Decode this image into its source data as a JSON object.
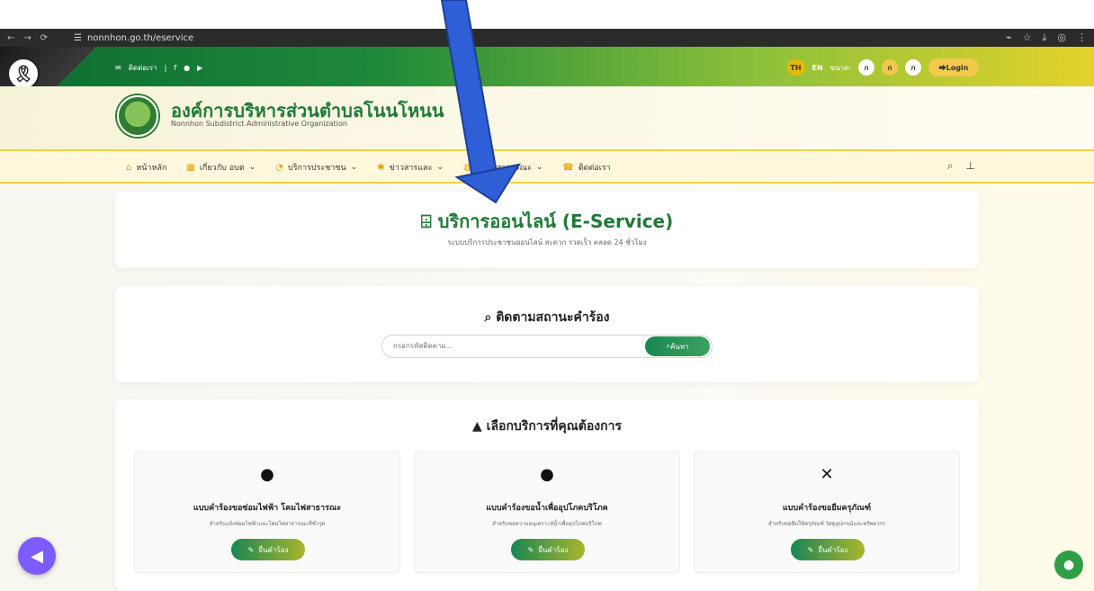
{
  "browser": {
    "url": "nonnhon.go.th/eservice"
  },
  "topbar": {
    "contact": "ติดต่อเรา",
    "lang_th": "TH",
    "lang_en": "EN",
    "size_label": "ขนาด:",
    "size_options": [
      "ก",
      "ก",
      "ก"
    ],
    "login": "Login"
  },
  "header": {
    "org_name": "องค์การบริหารส่วนตำบลโนนโหนน",
    "org_sub": "Nonnhon Subdistrict Administrative Organization"
  },
  "nav": {
    "items": [
      "หน้าหลัก",
      "เกี่ยวกับ อบต",
      "บริการประชาชน",
      "ข่าวสารและ",
      "ข้อมูลสาธารณะ",
      "ติดต่อเรา"
    ]
  },
  "hero": {
    "title": "บริการออนไลน์ (E-Service)",
    "subtitle": "ระบบบริการประชาชนออนไลน์ สะดวก รวดเร็ว ตลอด 24 ชั่วโมง"
  },
  "track": {
    "title": "ติดตามสถานะคำร้อง",
    "placeholder": "กรอกรหัสติดตาม...",
    "button": "ค้นหา"
  },
  "services": {
    "title": "เลือกบริการที่คุณต้องการ",
    "cards": [
      {
        "title": "แบบคำร้องขอซ่อมไฟฟ้า โคมไฟสาธารณะ",
        "desc": "สำหรับแจ้งซ่อมไฟฟ้าและโคมไฟสาธารณะที่ชำรุด",
        "button": "ยื่นคำร้อง",
        "icon": "lightbulb-icon"
      },
      {
        "title": "แบบคำร้องขอน้ำเพื่ออุปโภคบริโภค",
        "desc": "สำหรับขอความอนุเคราะห์น้ำเพื่ออุปโภคบริโภค",
        "button": "ยื่นคำร้อง",
        "icon": "water-drop-icon"
      },
      {
        "title": "แบบคำร้องขอยืมครุภัณฑ์",
        "desc": "สำหรับขอยืมใช้ครุภัณฑ์ วัสดุอุปกรณ์และทรัพยากร",
        "button": "ยื่นคำร้อง",
        "icon": "tools-icon"
      }
    ]
  },
  "colors": {
    "green": "#1f7a36",
    "gold": "#f2c94c",
    "blue_arrow": "#2f5fd6"
  }
}
